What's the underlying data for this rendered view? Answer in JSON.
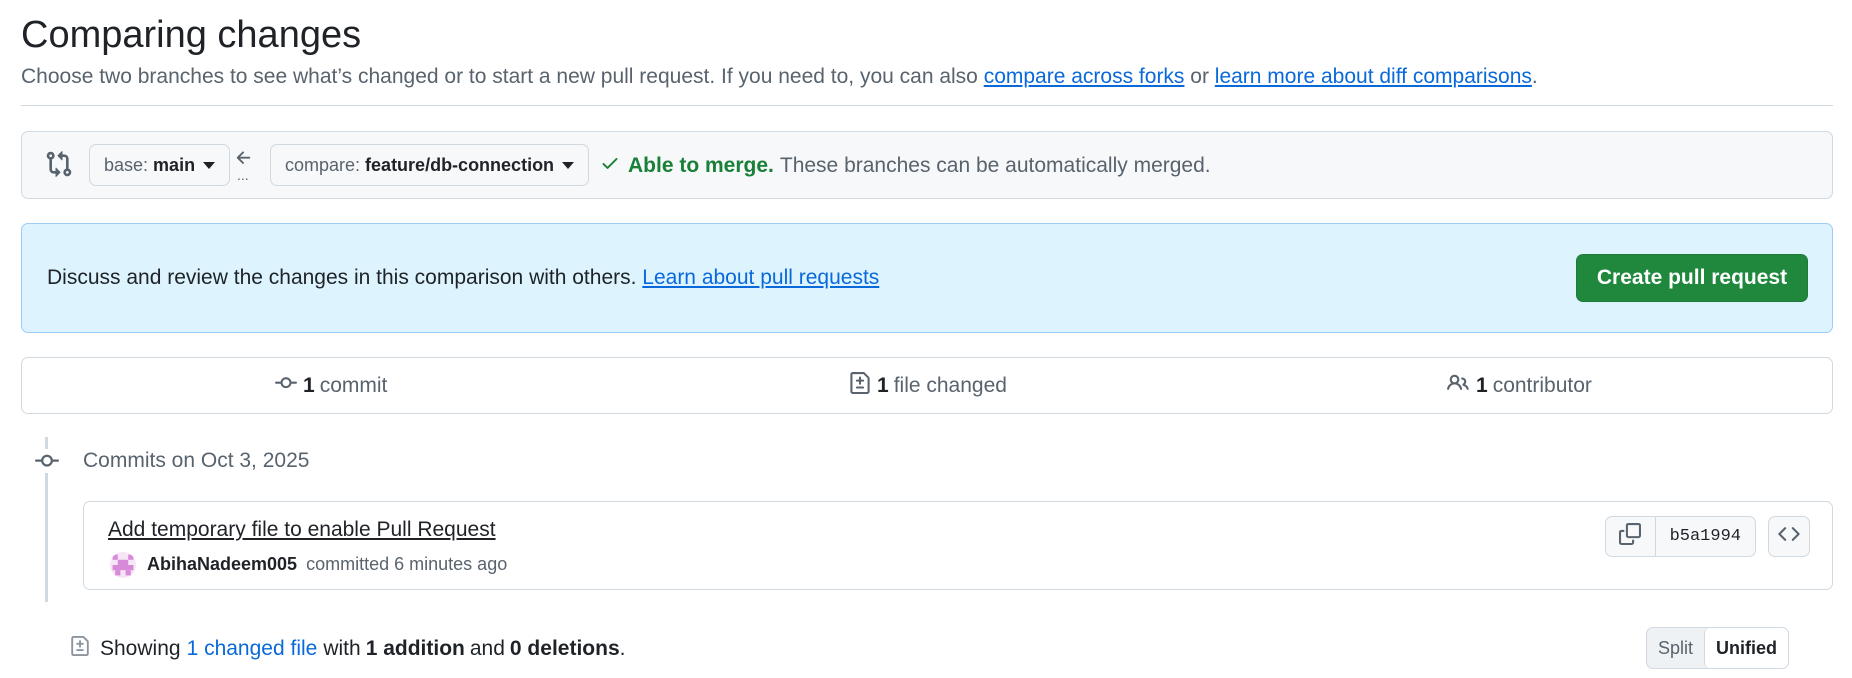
{
  "header": {
    "title": "Comparing changes",
    "subtitle_prefix": "Choose two branches to see what’s changed or to start a new pull request. If you need to, you can also ",
    "compare_forks_link": "compare across forks",
    "subtitle_mid": " or ",
    "diff_link": "learn more about diff comparisons",
    "subtitle_suffix": "."
  },
  "range": {
    "base_label": "base:",
    "base_value": "main",
    "compare_label": "compare:",
    "compare_value": "feature/db-connection",
    "ellipsis": "...",
    "merge_ok": "Able to merge.",
    "merge_msg": "These branches can be automatically merged."
  },
  "info": {
    "text": "Discuss and review the changes in this comparison with others. ",
    "link": "Learn about pull requests",
    "create_button": "Create pull request"
  },
  "stats": {
    "commits_count": "1",
    "commits_label": "commit",
    "files_count": "1",
    "files_label": "file changed",
    "contributors_count": "1",
    "contributors_label": "contributor"
  },
  "timeline": {
    "date_heading": "Commits on Oct 3, 2025",
    "commit": {
      "title": "Add temporary file to enable Pull Request",
      "author": "AbihaNadeem005",
      "action": "committed",
      "time": "6 minutes ago",
      "sha": "b5a1994"
    }
  },
  "summary": {
    "showing": "Showing",
    "changed_link": "1 changed file",
    "with": "with",
    "additions": "1 addition",
    "and": "and",
    "deletions": "0 deletions",
    "period": "."
  },
  "view_toggle": {
    "split": "Split",
    "unified": "Unified",
    "selected": "Unified"
  },
  "colors": {
    "accent_link": "#0969da",
    "success": "#1a7f37",
    "create_button": "#1f883d",
    "info_bg": "#ddf4ff"
  }
}
